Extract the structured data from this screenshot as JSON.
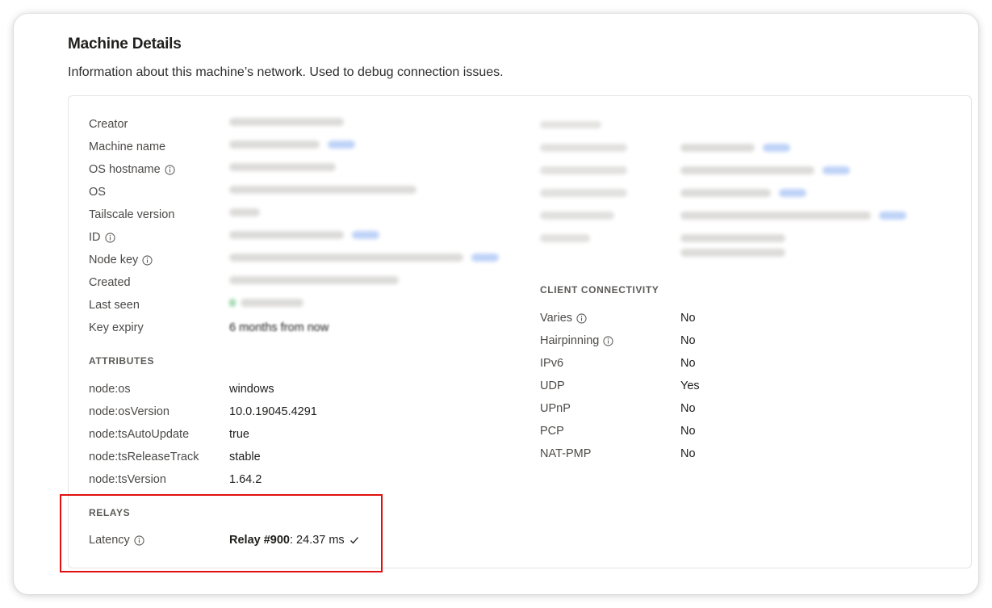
{
  "header": {
    "title": "Machine Details",
    "subtitle": "Information about this machine’s network. Used to debug connection issues."
  },
  "details": [
    {
      "label": "Creator",
      "info": false
    },
    {
      "label": "Machine name",
      "info": false
    },
    {
      "label": "OS hostname",
      "info": true
    },
    {
      "label": "OS",
      "info": false
    },
    {
      "label": "Tailscale version",
      "info": false
    },
    {
      "label": "ID",
      "info": true
    },
    {
      "label": "Node key",
      "info": true
    },
    {
      "label": "Created",
      "info": false
    },
    {
      "label": "Last seen",
      "info": false
    },
    {
      "label": "Key expiry",
      "info": false,
      "value": "6 months from now"
    }
  ],
  "attributes": {
    "heading": "ATTRIBUTES",
    "rows": [
      {
        "label": "node:os",
        "value": "windows"
      },
      {
        "label": "node:osVersion",
        "value": "10.0.19045.4291"
      },
      {
        "label": "node:tsAutoUpdate",
        "value": "true"
      },
      {
        "label": "node:tsReleaseTrack",
        "value": "stable"
      },
      {
        "label": "node:tsVersion",
        "value": "1.64.2"
      }
    ]
  },
  "relays": {
    "heading": "RELAYS",
    "latency_label": "Latency",
    "relay_name": "Relay #900",
    "relay_latency": ": 24.37 ms"
  },
  "client_connectivity": {
    "heading": "CLIENT CONNECTIVITY",
    "rows": [
      {
        "label": "Varies",
        "info": true,
        "value": "No"
      },
      {
        "label": "Hairpinning",
        "info": true,
        "value": "No"
      },
      {
        "label": "IPv6",
        "info": false,
        "value": "No"
      },
      {
        "label": "UDP",
        "info": false,
        "value": "Yes"
      },
      {
        "label": "UPnP",
        "info": false,
        "value": "No"
      },
      {
        "label": "PCP",
        "info": false,
        "value": "No"
      },
      {
        "label": "NAT-PMP",
        "info": false,
        "value": "No"
      }
    ]
  },
  "colors": {
    "highlight": "#e01010",
    "copy_link": "#3b82f6",
    "online": "#22a55a"
  },
  "icons": {
    "info": "info-circle-icon",
    "check": "checkmark-icon"
  }
}
